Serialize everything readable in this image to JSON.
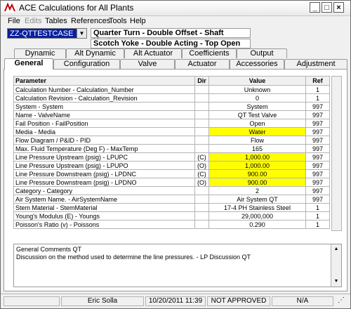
{
  "window": {
    "title": "ACE Calculations for All Plants"
  },
  "menu": [
    "File",
    "Edits",
    "Tables",
    "References",
    "Tools",
    "Help"
  ],
  "case_combo": {
    "value": "ZZ-QTTESTCASE"
  },
  "descriptions": [
    "Quarter Turn - Double Offset - Shaft Upstream",
    "Scotch Yoke - Double Acting - Top Open"
  ],
  "tabs_top": [
    "Dynamic",
    "Alt Dynamic",
    "Alt Actuator",
    "Coefficients",
    "Output"
  ],
  "tabs_bottom": [
    "General",
    "Configuration",
    "Valve",
    "Actuator",
    "Accessories",
    "Adjustment Factors"
  ],
  "active_tab": "General",
  "grid": {
    "headers": {
      "param": "Parameter",
      "dir": "Dir",
      "value": "Value",
      "ref": "Ref"
    },
    "rows": [
      {
        "param": "Calculation Number - Calculation_Number",
        "dir": "",
        "value": "Unknown",
        "ref": "1",
        "hl": false
      },
      {
        "param": "Calculation Revision - Calculation_Revision",
        "dir": "",
        "value": "0",
        "ref": "1",
        "hl": false
      },
      {
        "param": "System - System",
        "dir": "",
        "value": "System",
        "ref": "997",
        "hl": false
      },
      {
        "param": "Name - ValveName",
        "dir": "",
        "value": "QT Test Valve",
        "ref": "997",
        "hl": false
      },
      {
        "param": "Fail Position - FailPosition",
        "dir": "",
        "value": "Open",
        "ref": "997",
        "hl": false
      },
      {
        "param": "Media - Media",
        "dir": "",
        "value": "Water",
        "ref": "997",
        "hl": true
      },
      {
        "param": "Flow Diagram / P&ID - PID",
        "dir": "",
        "value": "Flow",
        "ref": "997",
        "hl": false
      },
      {
        "param": "Max. Fluid Temperature (Deg F) - MaxTemp",
        "dir": "",
        "value": "165",
        "ref": "997",
        "hl": false
      },
      {
        "param": "Line Pressure Upstream (psig) - LPUPC",
        "dir": "(C)",
        "value": "1,000.00",
        "ref": "997",
        "hl": true
      },
      {
        "param": "Line Pressure Upstream (psig) - LPUPO",
        "dir": "(O)",
        "value": "1,000.00",
        "ref": "997",
        "hl": true
      },
      {
        "param": "Line Pressure Downstream (psig) - LPDNC",
        "dir": "(C)",
        "value": "900.00",
        "ref": "997",
        "hl": true
      },
      {
        "param": "Line Pressure Downstream (psig) - LPDNO",
        "dir": "(O)",
        "value": "900.00",
        "ref": "997",
        "hl": true
      },
      {
        "param": "Category - Category",
        "dir": "",
        "value": "2",
        "ref": "997",
        "hl": false
      },
      {
        "param": "Air System Name. - AirSystemName",
        "dir": "",
        "value": "Air System QT",
        "ref": "997",
        "hl": false
      },
      {
        "param": "Stem Material - StemMaterial",
        "dir": "",
        "value": "17-4 PH Stainless Steel",
        "ref": "1",
        "hl": false
      },
      {
        "param": "Young's Modulus (E) - Youngs",
        "dir": "",
        "value": "29,000,000",
        "ref": "1",
        "hl": false
      },
      {
        "param": "Poisson's Ratio (v) - Poissons",
        "dir": "",
        "value": "0.290",
        "ref": "1",
        "hl": false
      }
    ]
  },
  "comments": [
    "General Comments QT",
    "Discussion on the method used to determine the line pressures. - LP Discussion QT"
  ],
  "status": {
    "user": "Eric Solla",
    "date": "10/20/2011 11:39",
    "approval": "NOT APPROVED",
    "na": "N/A"
  },
  "colors": {
    "highlight": "#ffff00",
    "combo_bg": "#0a1fa0"
  }
}
